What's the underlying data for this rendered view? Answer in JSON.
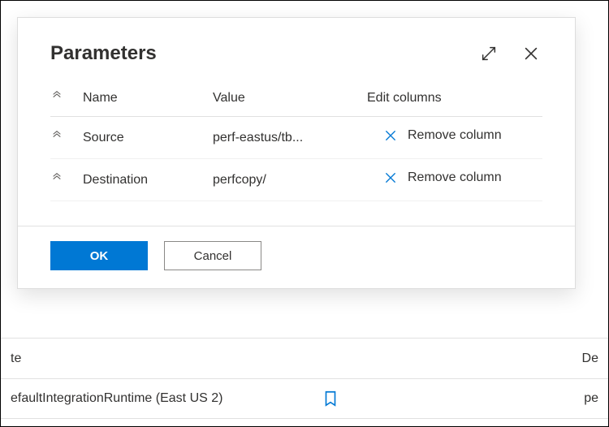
{
  "dialog": {
    "title": "Parameters",
    "headers": {
      "name": "Name",
      "value": "Value",
      "edit": "Edit columns"
    },
    "rows": [
      {
        "name": "Source",
        "value": "perf-eastus/tb...",
        "remove_label": "Remove column"
      },
      {
        "name": "Destination",
        "value": "perfcopy/",
        "remove_label": "Remove column"
      }
    ],
    "buttons": {
      "ok": "OK",
      "cancel": "Cancel"
    }
  },
  "background": {
    "row_a_left": "te",
    "row_a_right": "De",
    "row_b_left": "efaultIntegrationRuntime (East US 2)",
    "row_b_right": "pe"
  }
}
